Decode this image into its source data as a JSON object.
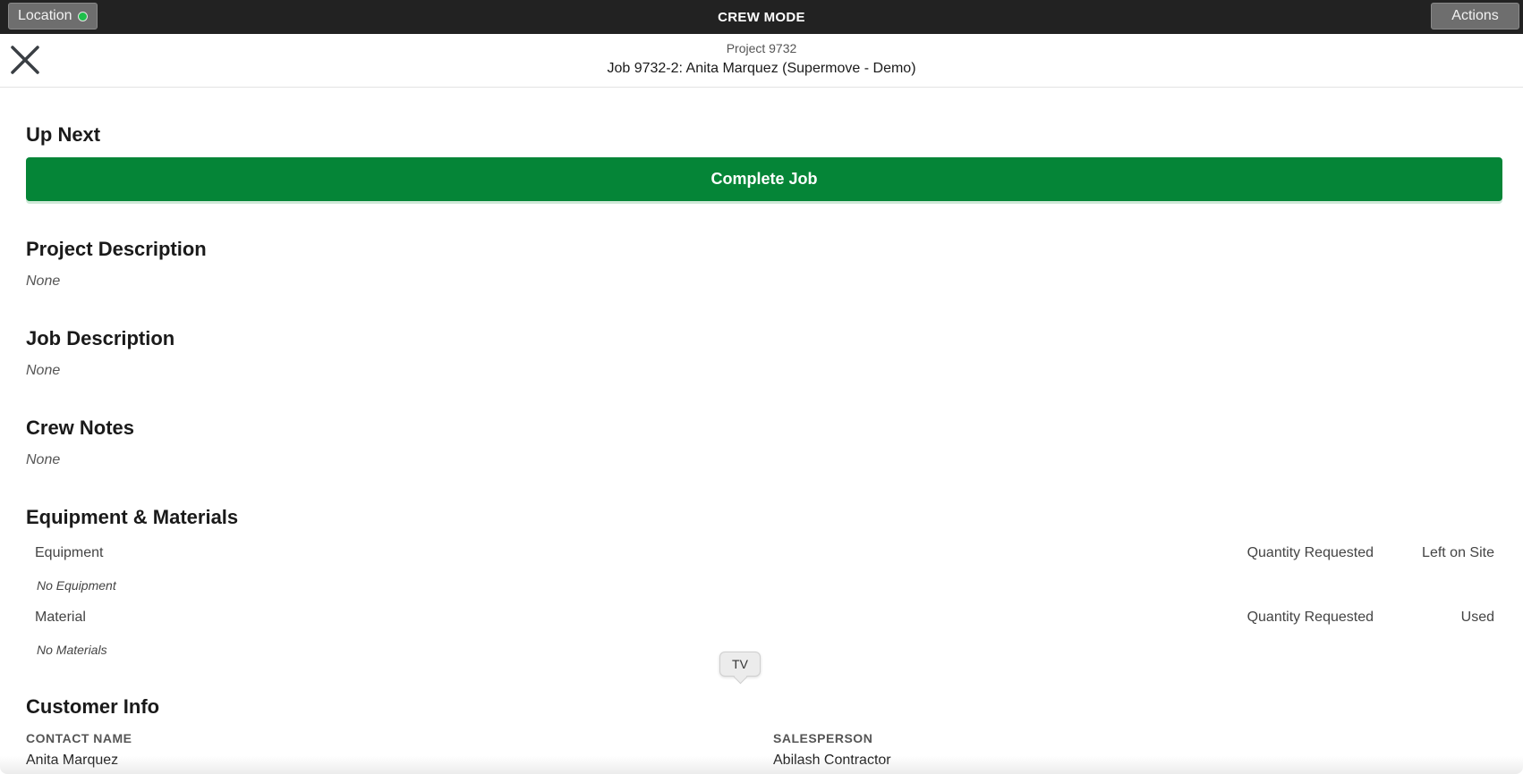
{
  "topbar": {
    "title": "CREW MODE",
    "location_label": "Location",
    "actions_label": "Actions"
  },
  "header": {
    "project": "Project 9732",
    "job": "Job 9732-2: Anita Marquez (Supermove - Demo)"
  },
  "up_next": {
    "title": "Up Next",
    "complete_label": "Complete Job"
  },
  "project_description": {
    "title": "Project Description",
    "value": "None"
  },
  "job_description": {
    "title": "Job Description",
    "value": "None"
  },
  "crew_notes": {
    "title": "Crew Notes",
    "value": "None"
  },
  "equipment_materials": {
    "title": "Equipment & Materials",
    "equipment": {
      "header": "Equipment",
      "qty_header": "Quantity Requested",
      "last_header": "Left on Site",
      "empty": "No Equipment"
    },
    "material": {
      "header": "Material",
      "qty_header": "Quantity Requested",
      "last_header": "Used",
      "empty": "No Materials"
    }
  },
  "customer_info": {
    "title": "Customer Info",
    "contact_label": "CONTACT NAME",
    "contact_value": "Anita Marquez",
    "salesperson_label": "SALESPERSON",
    "salesperson_value": "Abilash Contractor"
  },
  "tv_badge": "TV",
  "colors": {
    "topbar": "#222222",
    "accent_green": "#058537",
    "location_dot": "#1dbf4a"
  }
}
